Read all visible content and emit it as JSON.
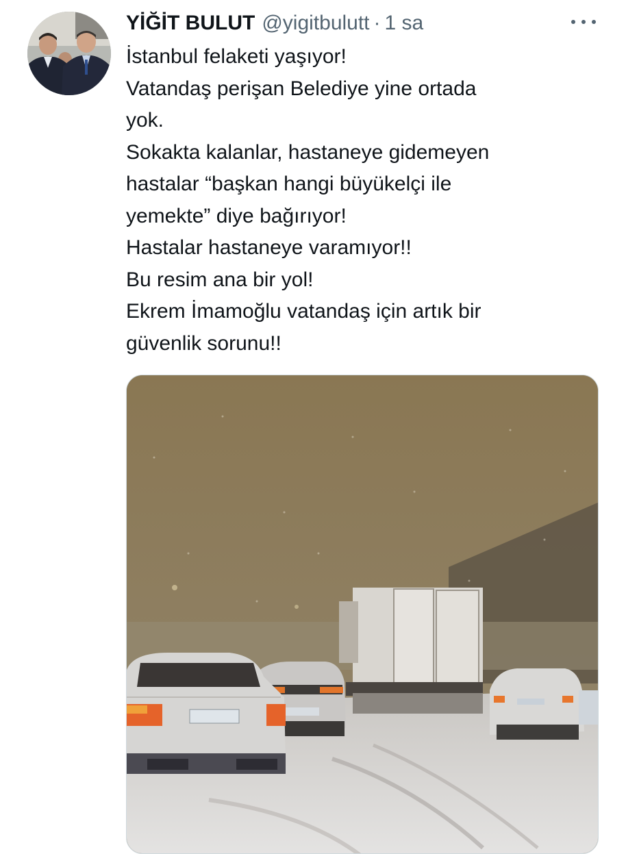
{
  "tweet": {
    "author_name": "YİĞİT BULUT",
    "author_handle": "@yigitbulutt",
    "separator": "·",
    "time": "1 sa",
    "lines": [
      "İstanbul felaketi yaşıyor!",
      "Vatandaş perişan Belediye yine ortada",
      "yok.",
      "Sokakta kalanlar, hastaneye gidemeyen",
      "hastalar “başkan hangi büyükelçi ile",
      "yemekte” diye bağırıyor!",
      "Hastalar hastaneye varamıyor!!",
      "Bu resim ana bir yol!",
      "Ekrem İmamoğlu vatandaş için artık bir",
      "güvenlik sorunu!!"
    ]
  },
  "icons": {
    "more": "more-horizontal-icon"
  },
  "colors": {
    "text_primary": "#0f1419",
    "text_secondary": "#536471",
    "media_sky": "#8f7d5c"
  }
}
